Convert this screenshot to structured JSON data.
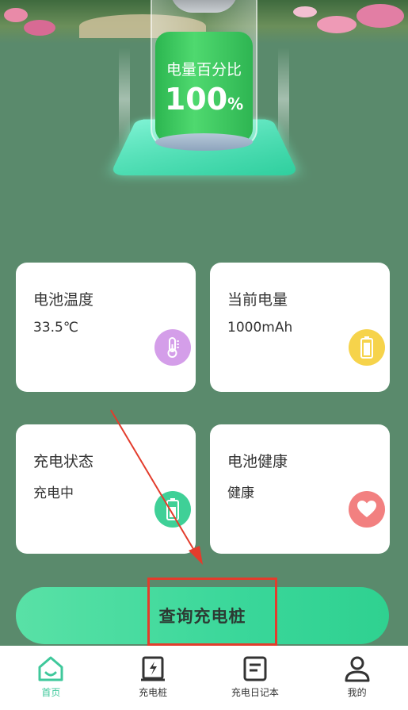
{
  "battery": {
    "label": "电量百分比",
    "value": "100",
    "unit": "%"
  },
  "cards": [
    {
      "title": "电池温度",
      "value": "33.5℃",
      "icon": "thermometer-icon",
      "color": "#d49ee9"
    },
    {
      "title": "当前电量",
      "value": "1000mAh",
      "icon": "battery-icon",
      "color": "#f6d34b"
    },
    {
      "title": "充电状态",
      "value": "充电中",
      "icon": "charging-icon",
      "color": "#3fd097"
    },
    {
      "title": "电池健康",
      "value": "健康",
      "icon": "heart-icon",
      "color": "#f28080"
    }
  ],
  "query_button": {
    "label": "查询充电桩"
  },
  "nav": {
    "items": [
      {
        "label": "首页",
        "icon": "home-icon",
        "active": true
      },
      {
        "label": "充电桩",
        "icon": "charging-pile-icon",
        "active": false
      },
      {
        "label": "充电日记本",
        "icon": "notebook-icon",
        "active": false
      },
      {
        "label": "我的",
        "icon": "profile-icon",
        "active": false
      }
    ]
  },
  "colors": {
    "background": "#5a8a6c",
    "accent": "#3fc89b",
    "annotation": "#e33c2c"
  }
}
